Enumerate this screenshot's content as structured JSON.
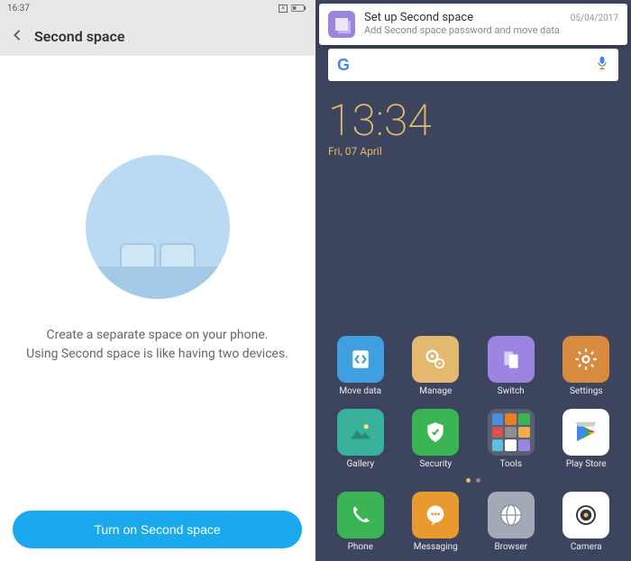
{
  "left": {
    "status": {
      "time": "16:37"
    },
    "header": {
      "title": "Second space"
    },
    "desc_line1": "Create a separate space on your phone.",
    "desc_line2": "Using Second space is like having two devices.",
    "cta": "Turn on Second space"
  },
  "right": {
    "notification": {
      "title": "Set up Second space",
      "subtitle": "Add Second space password and move data",
      "date": "05/04/2017"
    },
    "clock": {
      "time": "13:34",
      "date": "Fri, 07 April"
    },
    "apps_row1": [
      {
        "label": "Move data",
        "bg": "#3f9fe0"
      },
      {
        "label": "Manage",
        "bg": "#e2b96e"
      },
      {
        "label": "Switch",
        "bg": "#9c85e0"
      },
      {
        "label": "Settings",
        "bg": "#d88a3e"
      }
    ],
    "apps_row2": [
      {
        "label": "Gallery",
        "bg": "#39b29d"
      },
      {
        "label": "Security",
        "bg": "#3bb553"
      },
      {
        "label": "Tools",
        "bg": "#5a5f74"
      },
      {
        "label": "Play Store",
        "bg": "#ffffff"
      }
    ],
    "dock": [
      {
        "label": "Phone",
        "bg": "#3bb553"
      },
      {
        "label": "Messaging",
        "bg": "#e89a2e"
      },
      {
        "label": "Browser",
        "bg": "#a4a9b7"
      },
      {
        "label": "Camera",
        "bg": "#ffffff"
      }
    ]
  }
}
